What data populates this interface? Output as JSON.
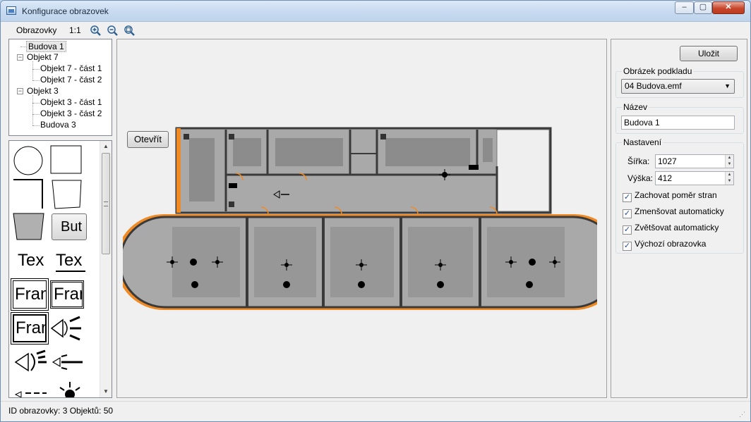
{
  "window": {
    "title": "Konfigurace obrazovek"
  },
  "window_buttons": {
    "minimize": "–",
    "maximize": "▢",
    "close": "✕"
  },
  "menu": {
    "screens": "Obrazovky",
    "scale": "1:1"
  },
  "toolbar_icons": [
    "zoom-in-icon",
    "zoom-out-icon",
    "zoom-fit-icon"
  ],
  "tree": {
    "items": [
      {
        "label": "Budova 1",
        "selected": true
      },
      {
        "label": "Objekt 7",
        "expanded": true
      },
      {
        "label": "Objekt 7 - část 1"
      },
      {
        "label": "Objekt 7 - část 2"
      },
      {
        "label": "Objekt 3",
        "expanded": true
      },
      {
        "label": "Objekt 3 - část 1"
      },
      {
        "label": "Objekt 3 - část 2"
      },
      {
        "label": "Budova 3"
      }
    ],
    "expander": "−"
  },
  "palette": {
    "shapes": [
      "circle",
      "rectangle",
      "corner",
      "quadrilateral",
      "trapezoid",
      "button",
      "text",
      "text-underline",
      "frame",
      "frame-double",
      "frame-bold",
      "speaker-left",
      "speaker-ear",
      "speaker-lines",
      "speaker-small",
      "light"
    ],
    "button_label": "But",
    "text_label": "Tex",
    "frame_label": "Fran"
  },
  "canvas": {
    "open_button": "Otevřít"
  },
  "right_panel": {
    "save_button": "Uložit",
    "background_image": {
      "label": "Obrázek podkladu",
      "value": "04 Budova.emf"
    },
    "name": {
      "label": "Název",
      "value": "Budova 1"
    },
    "settings": {
      "label": "Nastavení",
      "width_label": "Šířka:",
      "width_value": "1027",
      "height_label": "Výška:",
      "height_value": "412",
      "checkboxes": [
        {
          "label": "Zachovat poměr stran",
          "checked": true
        },
        {
          "label": "Zmenšovat automaticky",
          "checked": true
        },
        {
          "label": "Zvětšovat automaticky",
          "checked": true
        },
        {
          "label": "Výchozí obrazovka",
          "checked": true
        }
      ]
    }
  },
  "status": {
    "text": "ID obrazovky: 3  Objektů: 50"
  },
  "colors": {
    "wall": "#3a3a3a",
    "floor": "#a8a8a8",
    "accent_orange": "#f08a24",
    "furniture": "#8c8c8c"
  }
}
